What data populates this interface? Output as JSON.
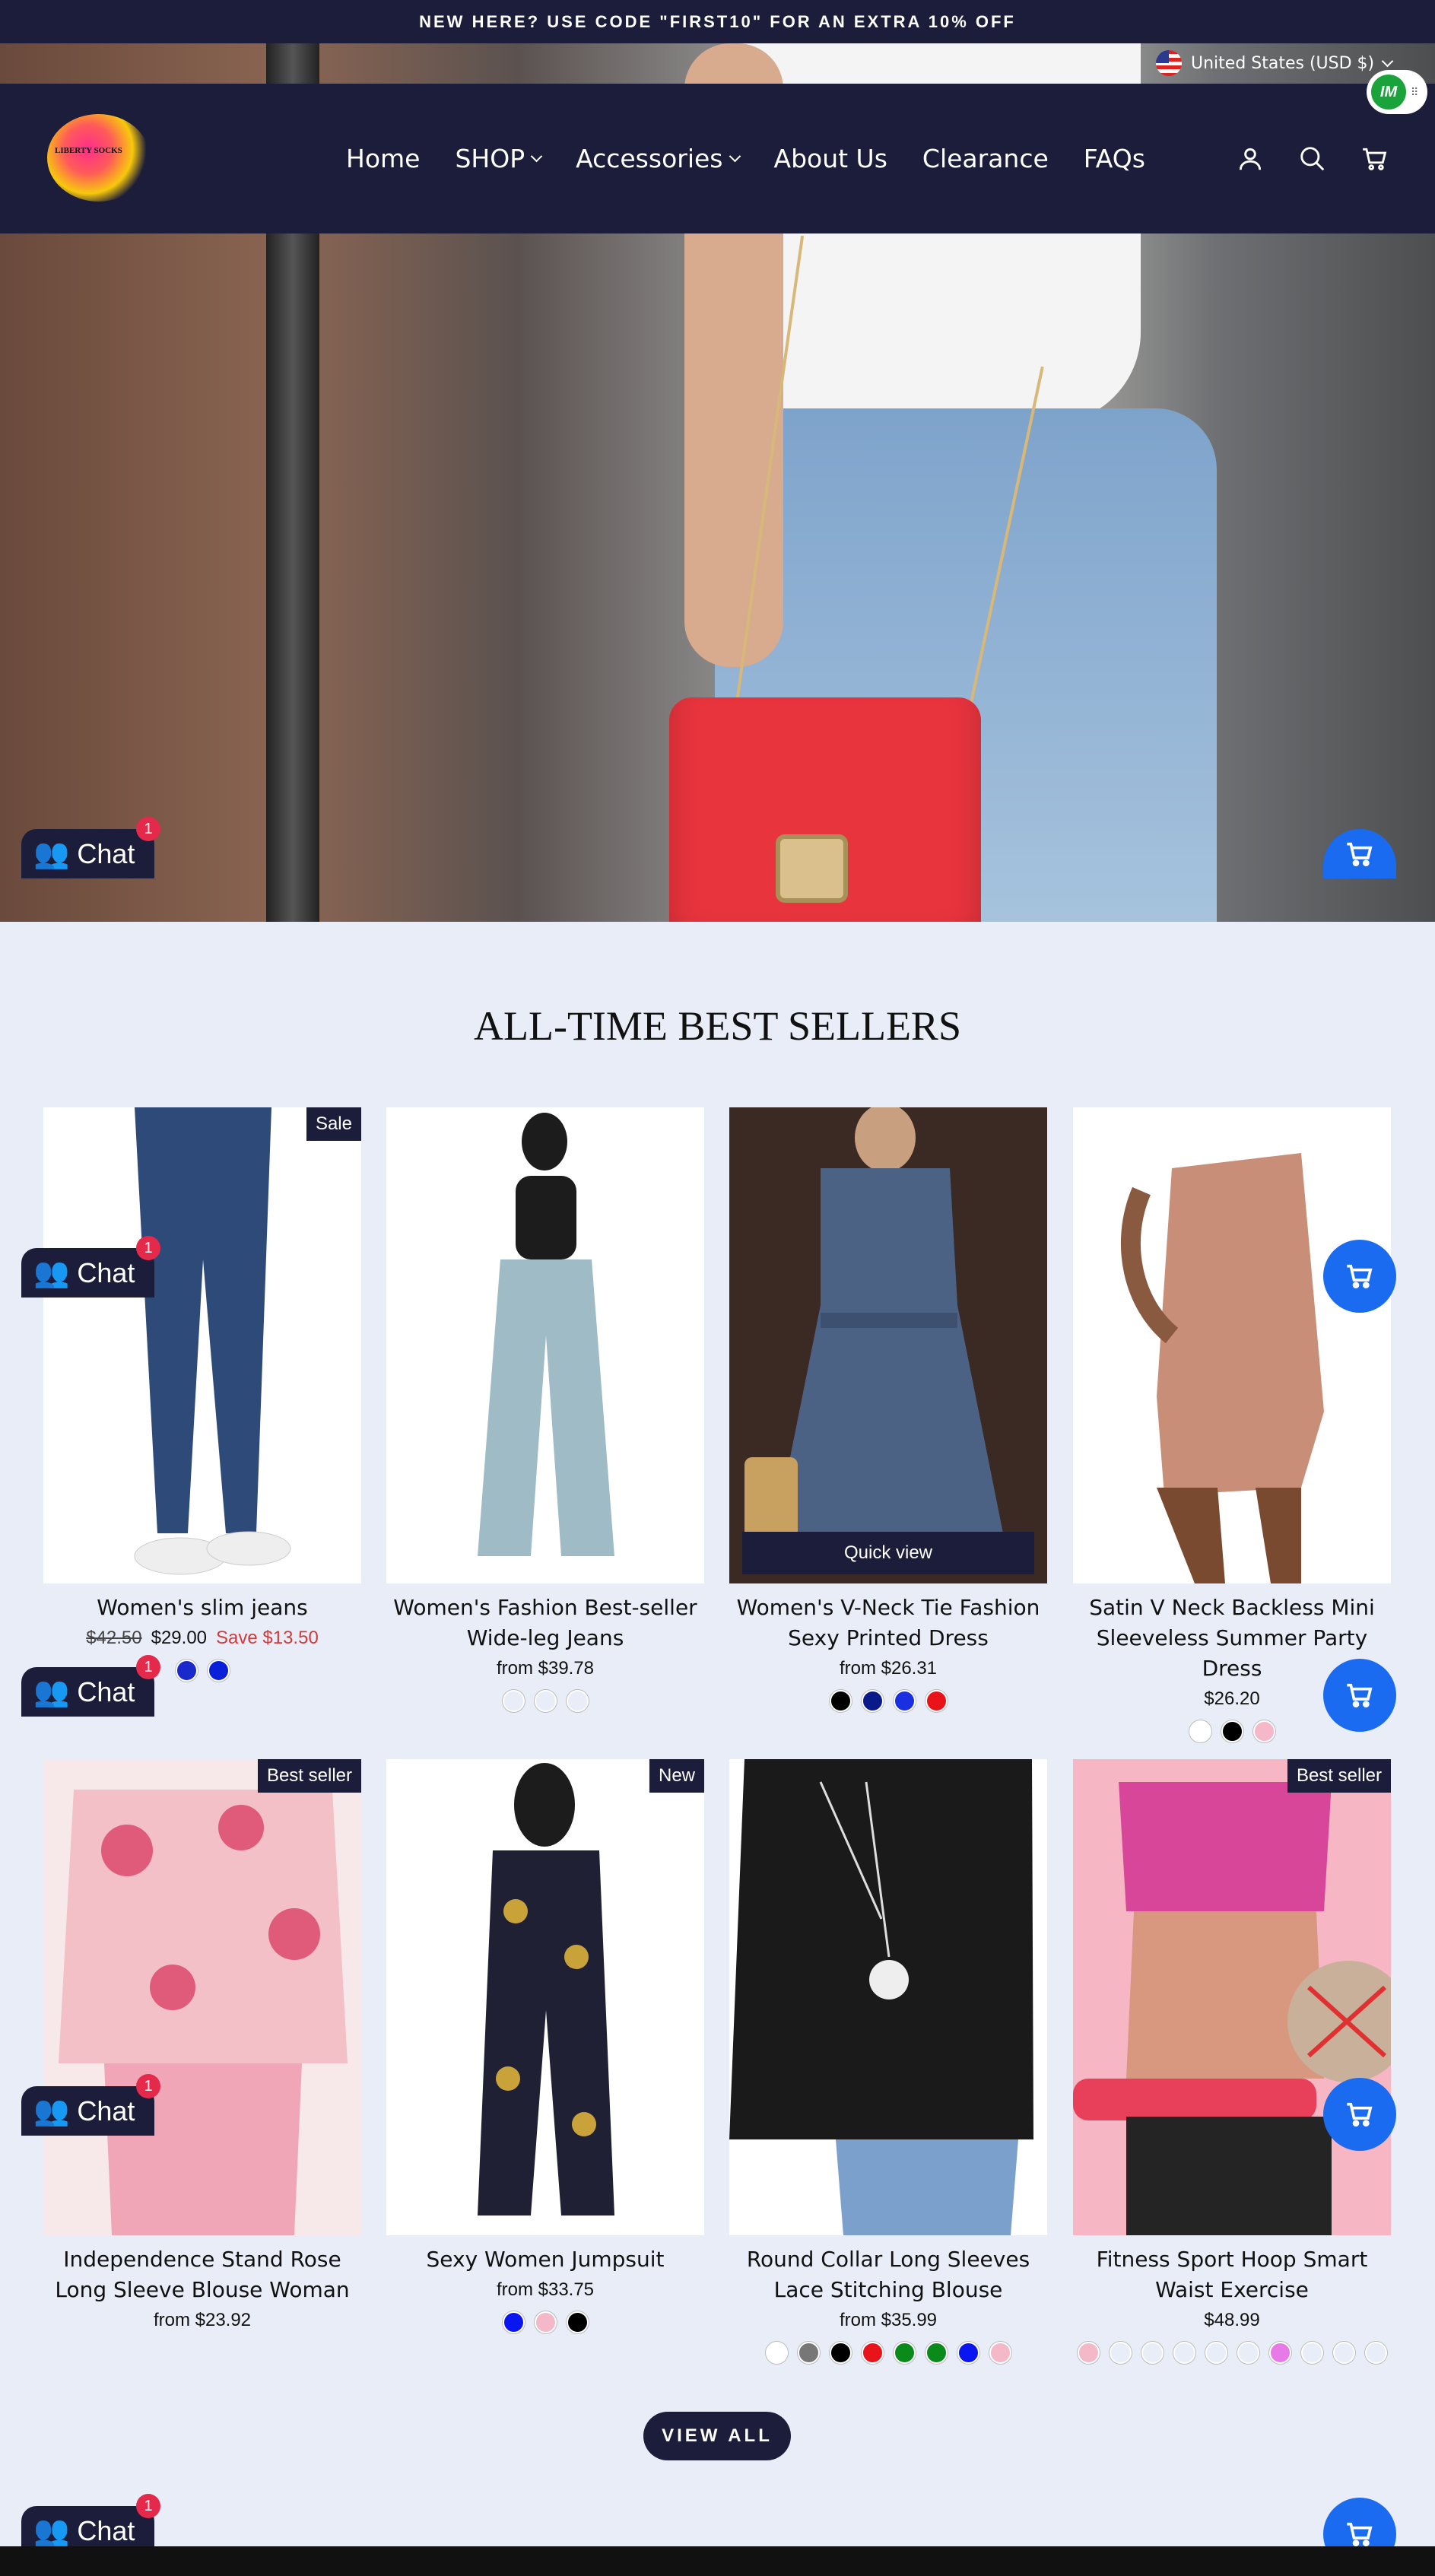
{
  "announcement": "NEW HERE? USE CODE \"FIRST10\" FOR AN EXTRA 10% OFF",
  "locale": "United States (USD $)",
  "brand": {
    "logo_text": "LIBERTY SOCKS"
  },
  "nav": [
    {
      "label": "Home",
      "dropdown": false
    },
    {
      "label": "SHOP",
      "dropdown": true
    },
    {
      "label": "Accessories",
      "dropdown": true
    },
    {
      "label": "About Us",
      "dropdown": false
    },
    {
      "label": "Clearance",
      "dropdown": false
    },
    {
      "label": "FAQs",
      "dropdown": false
    }
  ],
  "header_icons": [
    "account-icon",
    "search-icon",
    "cart-icon"
  ],
  "im_widget": {
    "label": "IM"
  },
  "section_title": "ALL-TIME BEST SELLERS",
  "quick_view": "Quick view",
  "products": [
    {
      "name": "Women's slim jeans",
      "badge": "Sale",
      "price": "$29.00",
      "compare": "$42.50",
      "save": "Save $13.50",
      "swatches": [
        "#1a29c9",
        "#0a1fd8"
      ]
    },
    {
      "name": "Women's Fashion Best-seller Wide-leg Jeans",
      "badge": "",
      "price": "from $39.78",
      "swatches": [
        "#e8edf7",
        "#e8edf7",
        "#e8edf7"
      ]
    },
    {
      "name": "Women's V-Neck Tie Fashion Sexy Printed Dress",
      "badge": "",
      "price": "from $26.31",
      "swatches": [
        "#000000",
        "#0b1a8a",
        "#1a2fe0",
        "#e8141a"
      ]
    },
    {
      "name": "Satin V Neck Backless Mini Sleeveless Summer Party Dress",
      "badge": "",
      "price": "$26.20",
      "swatches": [
        "#ffffff",
        "#000000",
        "#f5b8c8"
      ]
    },
    {
      "name": "Independence Stand Rose Long Sleeve Blouse Woman",
      "badge": "Best seller",
      "price": "from $23.92",
      "swatches": []
    },
    {
      "name": "Sexy Women Jumpsuit",
      "badge": "New",
      "price": "from $33.75",
      "swatches": [
        "#0a16f0",
        "#f5b8c8",
        "#000000"
      ]
    },
    {
      "name": "Round Collar Long Sleeves Lace Stitching Blouse",
      "badge": "",
      "price": "from $35.99",
      "swatches": [
        "#ffffff",
        "#777777",
        "#000000",
        "#e8141a",
        "#0a8a1a",
        "#0a8a1a",
        "#0a16f0",
        "#f5b8c8"
      ]
    },
    {
      "name": "Fitness Sport Hoop Smart Waist Exercise",
      "badge": "Best seller",
      "price": "$48.99",
      "swatches": [
        "#f5b8c8",
        "#e8edf7",
        "#e8edf7",
        "#e8edf7",
        "#e8edf7",
        "#e8edf7",
        "#e87ae8",
        "#e8edf7",
        "#e8edf7",
        "#e8edf7"
      ]
    }
  ],
  "view_all": "VIEW ALL",
  "chat": {
    "label": "Chat",
    "count": "1"
  },
  "colors": {
    "navy": "#1c1d3a",
    "background": "#e8edf7",
    "sale_red": "#d23a3a",
    "chat_badge": "#e4294a",
    "cart_blue": "#1a6bf0"
  }
}
